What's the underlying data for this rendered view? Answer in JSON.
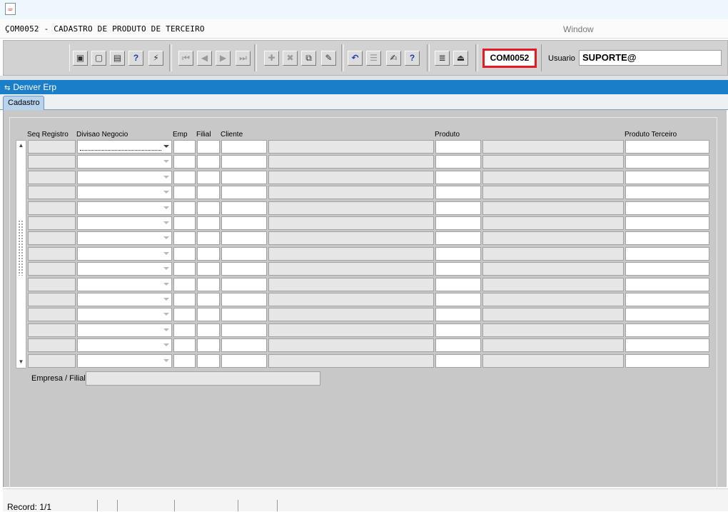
{
  "app": {
    "form_title": "ÇOM0052 - CADASTRO DE PRODUTO DE TERCEIRO",
    "menu_window": "Window",
    "module_code": "COM0052",
    "user_label": "Usuario",
    "user_value": "SUPORTE@"
  },
  "toolbar": {
    "buttons": [
      {
        "icon": "save-icon",
        "glyph": "▣"
      },
      {
        "icon": "window-icon",
        "glyph": "▢"
      },
      {
        "icon": "print-icon",
        "glyph": "▤"
      },
      {
        "icon": "query-help-icon",
        "glyph": "?"
      },
      {
        "icon": "execute-query-icon",
        "glyph": "⚡"
      },
      {
        "icon": "first-record-icon",
        "glyph": "⏮"
      },
      {
        "icon": "previous-record-icon",
        "glyph": "◀"
      },
      {
        "icon": "next-record-icon",
        "glyph": "▶"
      },
      {
        "icon": "last-record-icon",
        "glyph": "⏭"
      },
      {
        "icon": "insert-record-icon",
        "glyph": "✚"
      },
      {
        "icon": "delete-record-icon",
        "glyph": "✖"
      },
      {
        "icon": "duplicate-record-icon",
        "glyph": "⧉"
      },
      {
        "icon": "clear-record-icon",
        "glyph": "✎"
      },
      {
        "icon": "undo-icon",
        "glyph": "↶"
      },
      {
        "icon": "list-values-icon",
        "glyph": "☰"
      },
      {
        "icon": "edit-icon",
        "glyph": "✍"
      },
      {
        "icon": "help-icon",
        "glyph": "?"
      },
      {
        "icon": "menu-icon",
        "glyph": "≣"
      },
      {
        "icon": "exit-icon",
        "glyph": "⏏"
      }
    ]
  },
  "window": {
    "title": "Denver Erp",
    "tab": "Cadastro"
  },
  "grid": {
    "headers": {
      "seq_registro": "Seq Registro",
      "divisao_negocio": "Divisao Negocio",
      "emp": "Emp",
      "filial": "Filial",
      "cliente": "Cliente",
      "produto": "Produto",
      "produto_terceiro": "Produto Terceiro"
    },
    "row_count": 15
  },
  "footer": {
    "empresa_filial_label": "Empresa / Filial",
    "empresa_filial_value": ""
  },
  "status": {
    "record": "Record: 1/1"
  }
}
